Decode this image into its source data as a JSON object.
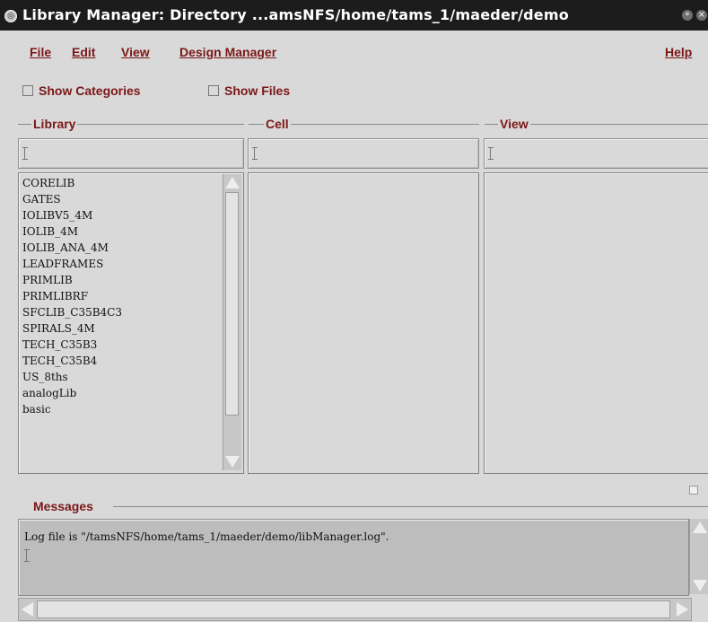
{
  "window": {
    "title": "Library Manager: Directory ...amsNFS/home/tams_1/maeder/demo",
    "window_icon": "app-icon",
    "controls": [
      "minimize-icon",
      "close-icon"
    ]
  },
  "menu": {
    "file": "File",
    "edit": "Edit",
    "view": "View",
    "design_manager": "Design Manager",
    "help": "Help"
  },
  "options": {
    "show_categories": "Show Categories",
    "show_files": "Show Files"
  },
  "panels": {
    "library": {
      "label": "Library",
      "filter": ""
    },
    "cell": {
      "label": "Cell",
      "filter": ""
    },
    "view": {
      "label": "View",
      "filter": ""
    }
  },
  "library_items": [
    "CORELIB",
    "GATES",
    "IOLIBV5_4M",
    "IOLIB_4M",
    "IOLIB_ANA_4M",
    "LEADFRAMES",
    "PRIMLIB",
    "PRIMLIBRF",
    "SFCLIB_C35B4C3",
    "SPIRALS_4M",
    "TECH_C35B3",
    "TECH_C35B4",
    "US_8ths",
    "analogLib",
    "basic"
  ],
  "messages": {
    "label": "Messages",
    "log_line": "Log file is \"/tamsNFS/home/tams_1/maeder/demo/libManager.log\"."
  },
  "colors": {
    "accent_text": "#7b1717",
    "background": "#d9d9d9",
    "title_bar": "#1c1c1c"
  }
}
